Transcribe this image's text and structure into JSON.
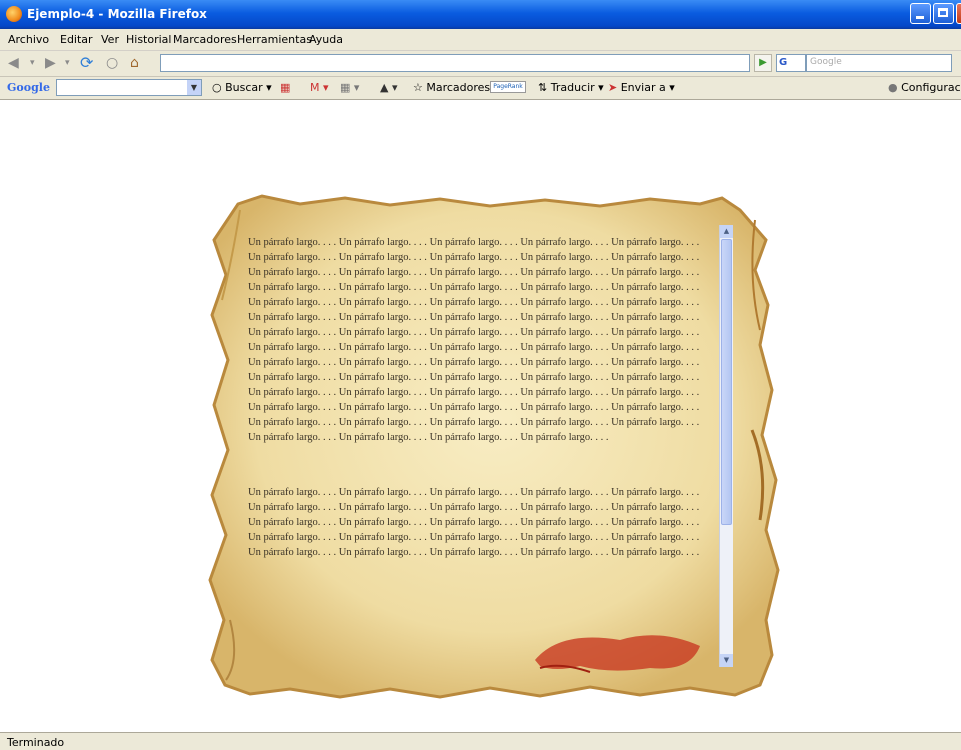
{
  "window": {
    "title": "Ejemplo-4 - Mozilla Firefox"
  },
  "menu": [
    "Archivo",
    "Editar",
    "Ver",
    "Historial",
    "Marcadores",
    "Herramientas",
    "Ayuda"
  ],
  "navigation": {
    "url": "",
    "search_engine": "G",
    "search_placeholder": "Google"
  },
  "google_toolbar": {
    "logo": "Google",
    "buscar_label": "Buscar",
    "marcadores_label": "Marcadores",
    "pagerank_label": "PageRank",
    "traducir_label": "Traducir",
    "enviar_label": "Enviar a",
    "configuracion_label": "Configuració"
  },
  "page": {
    "paragraphs": [
      {
        "fragment": "Un párrafo largo. . . . ",
        "repeat": 69
      },
      {
        "fragment": "Un párrafo largo. . . . ",
        "repeat": 25
      }
    ]
  },
  "status": {
    "text": "Terminado"
  }
}
